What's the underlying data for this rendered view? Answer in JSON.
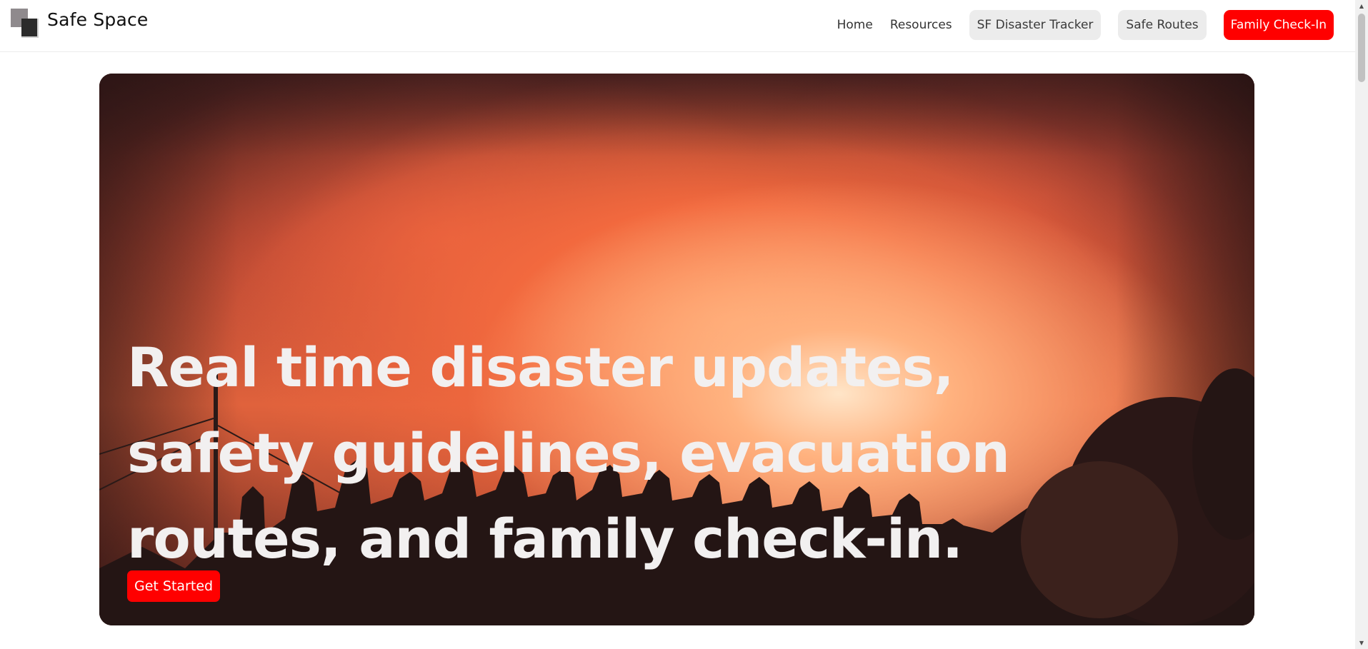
{
  "brand": {
    "name": "Safe Space",
    "logo_icon": "overlapping-squares-logo"
  },
  "nav": {
    "home": "Home",
    "resources": "Resources",
    "disaster_tracker": "SF Disaster Tracker",
    "safe_routes": "Safe Routes",
    "family_checkin": "Family Check-In"
  },
  "hero": {
    "headline": "Real time disaster updates, safety guidelines, evacuation routes, and family check-in.",
    "cta_label": "Get Started",
    "background_image": "crowd silhouetted against wildfire"
  },
  "colors": {
    "accent": "#ff0000",
    "pill_bg": "#ececec",
    "headline_text": "#f2f0f0"
  }
}
